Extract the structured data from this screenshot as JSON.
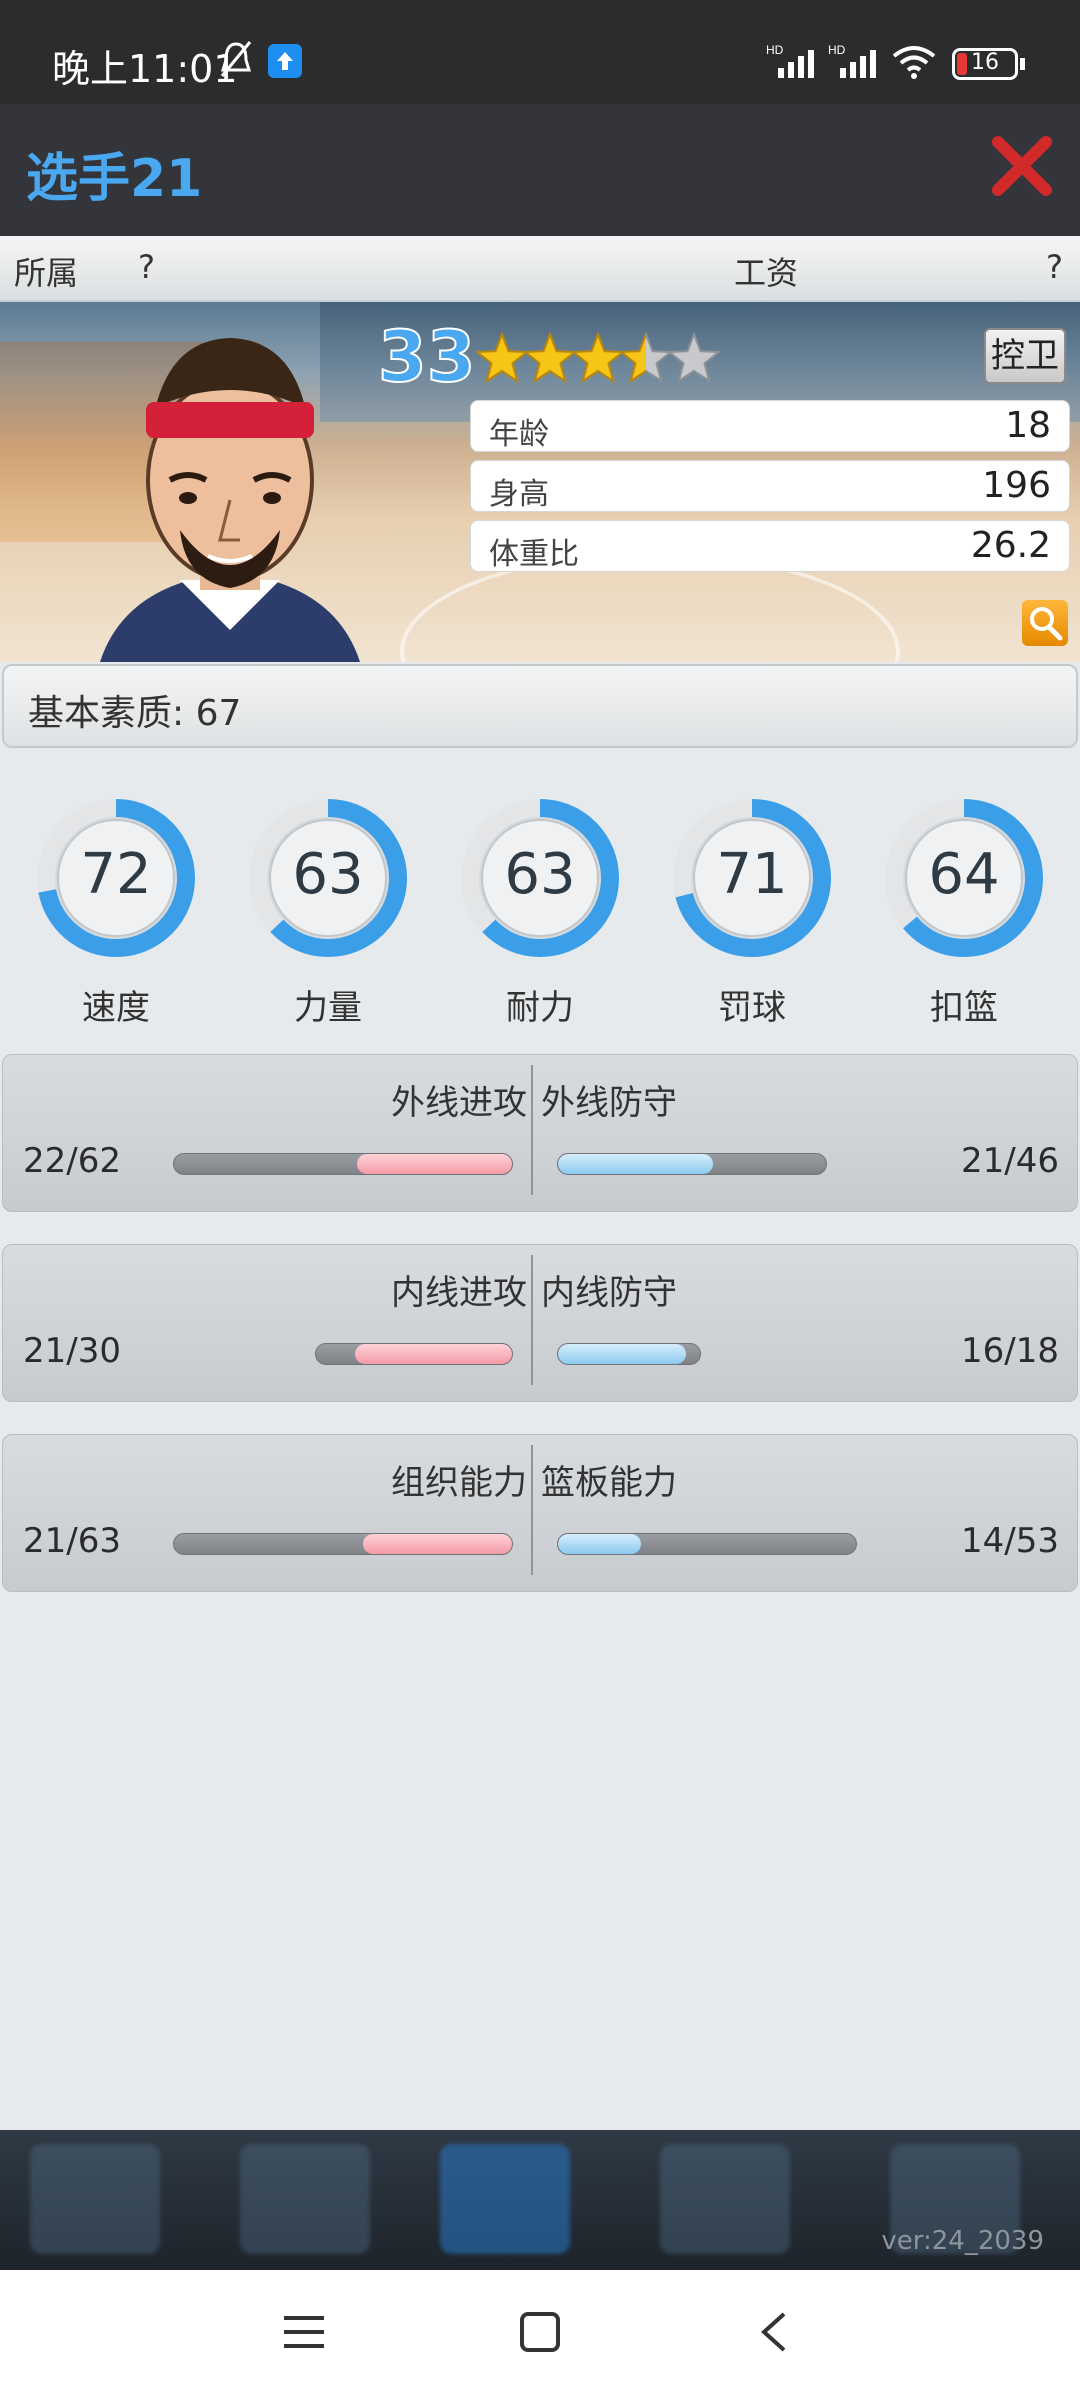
{
  "status_bar": {
    "time": "晚上11:01",
    "battery": "16"
  },
  "header": {
    "title": "选手21"
  },
  "info": {
    "owner_label": "所属",
    "owner_value": "?",
    "salary_label": "工资",
    "salary_value": "?"
  },
  "player": {
    "rating": "33",
    "stars": 3.5,
    "position": "控卫",
    "stats": [
      {
        "label": "年龄",
        "value": "18"
      },
      {
        "label": "身高",
        "value": "196"
      },
      {
        "label": "体重比",
        "value": "26.2"
      }
    ]
  },
  "base_quality": "基本素质: 67",
  "attributes": [
    {
      "label": "速度",
      "value": "72"
    },
    {
      "label": "力量",
      "value": "63"
    },
    {
      "label": "耐力",
      "value": "63"
    },
    {
      "label": "罚球",
      "value": "71"
    },
    {
      "label": "扣篮",
      "value": "64"
    }
  ],
  "compare_panels": [
    {
      "left_label": "外线进攻",
      "right_label": "外线防守",
      "left_value": "22/62",
      "right_value": "21/46"
    },
    {
      "left_label": "内线进攻",
      "right_label": "内线防守",
      "left_value": "21/30",
      "right_value": "16/18"
    },
    {
      "left_label": "组织能力",
      "right_label": "篮板能力",
      "left_value": "21/63",
      "right_value": "14/53"
    }
  ],
  "version": "ver:24_2039",
  "colors": {
    "accent": "#4aa8f0",
    "ring": "#3b9ee8",
    "attack_bar": "#f49aa6",
    "defense_bar": "#8cc9ef"
  }
}
